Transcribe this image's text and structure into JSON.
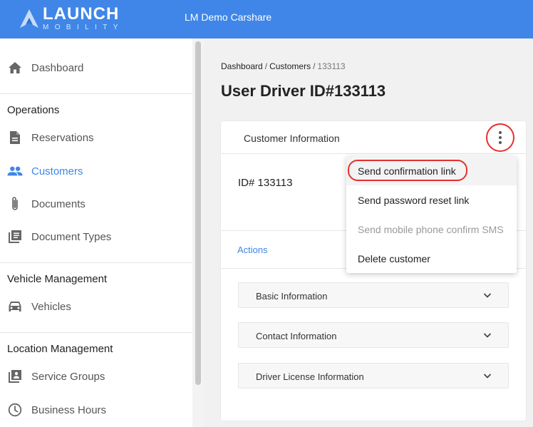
{
  "header": {
    "logo_word": "LAUNCH",
    "logo_sub": "MOBILITY",
    "app_title": "LM Demo Carshare"
  },
  "sidebar": {
    "dashboard": "Dashboard",
    "sections": {
      "operations": "Operations",
      "vehicle_management": "Vehicle Management",
      "location_management": "Location Management"
    },
    "items": {
      "reservations": "Reservations",
      "customers": "Customers",
      "documents": "Documents",
      "document_types": "Document Types",
      "vehicles": "Vehicles",
      "service_groups": "Service Groups",
      "business_hours": "Business Hours"
    },
    "active_color": "#3f86e8"
  },
  "breadcrumb": {
    "items": [
      "Dashboard",
      "Customers",
      "133113"
    ],
    "separator": "/"
  },
  "page": {
    "title": "User Driver ID#133113"
  },
  "card": {
    "header_title": "Customer Information",
    "id_text": "ID# 133113",
    "actions_tab": "Actions",
    "accordions": [
      "Basic Information",
      "Contact Information",
      "Driver License Information"
    ]
  },
  "menu": {
    "items": [
      {
        "label": "Send confirmation link",
        "state": "highlighted"
      },
      {
        "label": "Send password reset link",
        "state": "enabled"
      },
      {
        "label": "Send mobile phone confirm SMS",
        "state": "disabled"
      },
      {
        "label": "Delete customer",
        "state": "enabled"
      }
    ]
  },
  "colors": {
    "brand": "#3f86e8",
    "annotation_red": "#e53030"
  },
  "icons": [
    "home-icon",
    "document-icon",
    "people-icon",
    "paperclip-icon",
    "library-icon",
    "car-icon",
    "group-icon",
    "clock-icon",
    "more-vert-icon",
    "chevron-down-icon"
  ]
}
